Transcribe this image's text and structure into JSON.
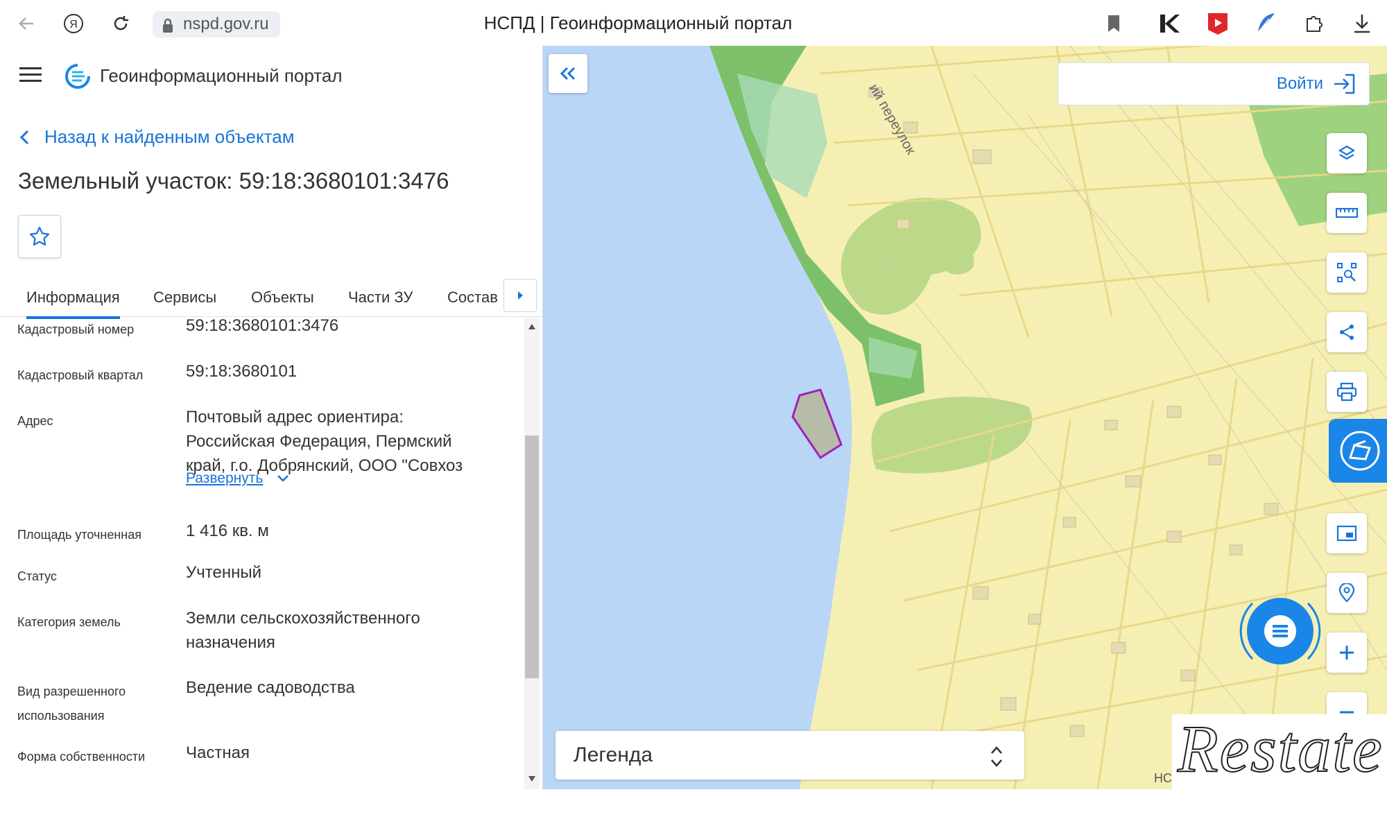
{
  "browser": {
    "url": "nspd.gov.ru",
    "title": "НСПД | Геоинформационный портал"
  },
  "app": {
    "name": "Геоинформационный портал"
  },
  "panel": {
    "back_label": "Назад к найденным объектам",
    "title": "Земельный участок: 59:18:3680101:3476",
    "tabs": [
      "Информация",
      "Сервисы",
      "Объекты",
      "Части ЗУ",
      "Состав"
    ],
    "properties": [
      {
        "label": "Кадастровый номер",
        "value": "59:18:3680101:3476"
      },
      {
        "label": "Кадастровый квартал",
        "value": "59:18:3680101"
      },
      {
        "label": "Адрес",
        "value_lines": [
          "Почтовый адрес ориентира:",
          "Российская Федерация, Пермский",
          "край, г.о. Добрянский, ООО \"Совхоз"
        ],
        "expand_label": "Развернуть"
      },
      {
        "label": "Площадь уточненная",
        "value": "1 416 кв. м"
      },
      {
        "label": "Статус",
        "value": "Учтенный"
      },
      {
        "label": "Категория земель",
        "value_lines": [
          "Земли сельскохозяйственного",
          "назначения"
        ]
      },
      {
        "label_lines": [
          "Вид разрешенного",
          "использования"
        ],
        "value": "Ведение садоводства"
      },
      {
        "label": "Форма собственности",
        "value": "Частная"
      }
    ]
  },
  "map": {
    "street_label": "ий переулок",
    "login_label": "Войти",
    "legend_label": "Легенда",
    "watermark": "Restate",
    "attribution": "НС"
  }
}
